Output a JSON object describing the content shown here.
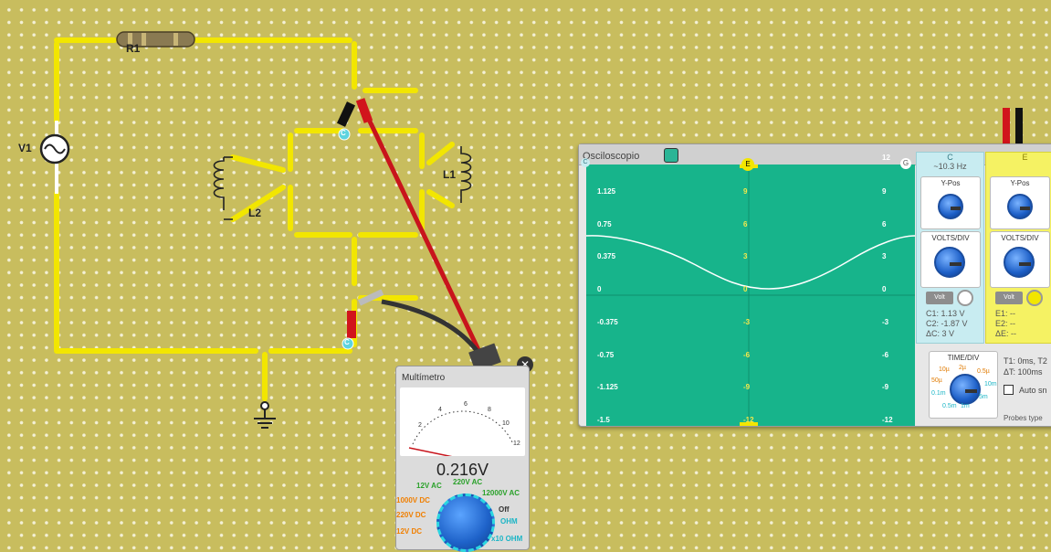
{
  "circuit": {
    "r1_label": "R1",
    "v1_label": "V1",
    "l1_label": "L1",
    "l2_label": "L2",
    "probe_c_label": "C",
    "probe_c2_label": "C"
  },
  "oscilloscope": {
    "title": "Osciloscopio",
    "marker_e": "E",
    "marker_g": "G",
    "marker_c": "C",
    "left_ticks": [
      "1.125",
      "0.75",
      "0.375",
      "0",
      "-0.375",
      "-0.75",
      "-1.125",
      "-1.5"
    ],
    "mid_ticks": [
      "9",
      "6",
      "3",
      "0",
      "-3",
      "-6",
      "-9",
      "-12"
    ],
    "right_ticks": [
      "9",
      "6",
      "3",
      "0",
      "-3",
      "-6",
      "-9",
      "-12"
    ],
    "top_right_tick": "12",
    "channel_c": {
      "label": "C",
      "freq": "~10.3 Hz",
      "ypos_label": "Y-Pos",
      "voltsdiv_label": "VOLTS/DIV",
      "volt_btn": "Volt",
      "readout": [
        "C1: 1.13 V",
        "C2: -1.87 V",
        "ΔC: 3 V"
      ]
    },
    "channel_e": {
      "label": "E",
      "ypos_label": "Y-Pos",
      "voltsdiv_label": "VOLTS/DIV",
      "volt_btn": "Volt",
      "readout": [
        "E1: --",
        "E2: --",
        "ΔE: --"
      ]
    },
    "time": {
      "label": "TIME/DIV",
      "marks": [
        "10µ",
        "2µ",
        "0.5µ",
        "50µ",
        "10m",
        "0.1m",
        "5m",
        "0.5m",
        "1m"
      ]
    },
    "time_readout": [
      "T1: 0ms, T2",
      "ΔT: 100ms"
    ],
    "auto_label": "Auto sn",
    "probes_type": "Probes type",
    "colors": {
      "screen": "#17b48b",
      "trace": "#ffffff",
      "channel_c": "#c8ecf1",
      "channel_e": "#f5f263"
    }
  },
  "multimeter": {
    "title": "Multímetro",
    "reading": "0.216V",
    "scale": [
      "2",
      "4",
      "6",
      "8",
      "10",
      "12"
    ],
    "range_labels": [
      "12V AC",
      "220V AC",
      "12000V AC",
      "1000V DC",
      "220V DC",
      "12V DC",
      "Off",
      "OHM",
      "x10 OHM"
    ],
    "close": "✕"
  }
}
